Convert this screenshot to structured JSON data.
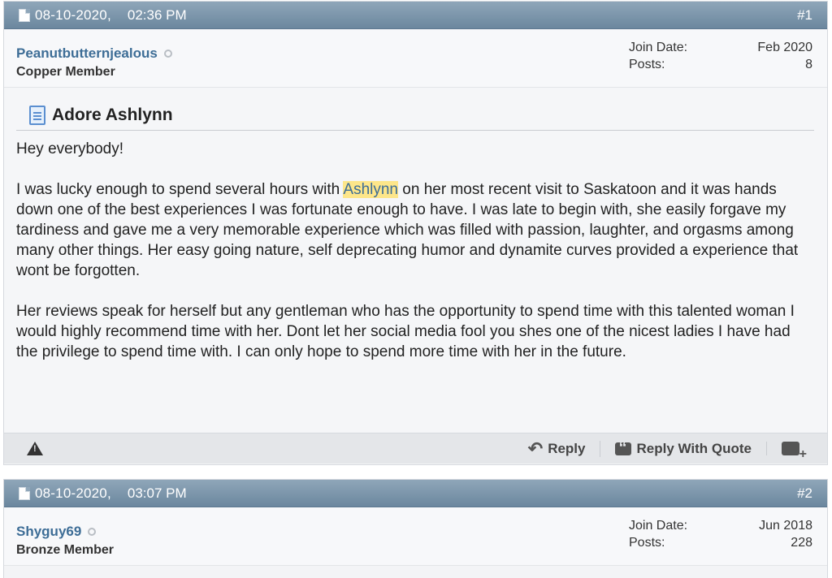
{
  "posts": [
    {
      "date": "08-10-2020,",
      "time": "02:36 PM",
      "number": "#1",
      "username": "Peanutbutternjealous",
      "usertitle": "Copper Member",
      "join_label": "Join Date:",
      "join_value": "Feb 2020",
      "posts_label": "Posts:",
      "posts_value": "8",
      "title": "Adore Ashlynn",
      "greeting": "Hey everybody!",
      "p1_before": "I was lucky enough to spend several hours with ",
      "p1_highlight": "Ashlynn",
      "p1_after": " on her most recent visit to Saskatoon and it was hands down one of the best experiences I was fortunate enough to have. I was late to begin with, she easily forgave my tardiness and gave me a very memorable experience which was filled with passion, laughter, and orgasms among many other things. Her easy going nature, self deprecating humor and dynamite curves provided a experience that wont be forgotten.",
      "p2": "Her reviews speak for herself but any gentleman who has the opportunity to spend time with this talented woman I would highly recommend time with her. Dont let her social media fool you shes one of the nicest ladies I have had the privilege to spend time with. I can only hope to spend more time with her in the future.",
      "actions": {
        "reply": "Reply",
        "reply_quote": "Reply With Quote"
      }
    },
    {
      "date": "08-10-2020,",
      "time": "03:07 PM",
      "number": "#2",
      "username": "Shyguy69",
      "usertitle": "Bronze Member",
      "join_label": "Join Date:",
      "join_value": "Jun 2018",
      "posts_label": "Posts:",
      "posts_value": "228"
    }
  ],
  "icons": {
    "doc": "document-icon",
    "warn": "report-icon",
    "reply": "reply-icon",
    "quote": "quote-icon",
    "multi": "multiquote-icon"
  },
  "colors": {
    "header": "#7a93a8",
    "username": "#3d6d96",
    "highlight": "#fde68a"
  }
}
